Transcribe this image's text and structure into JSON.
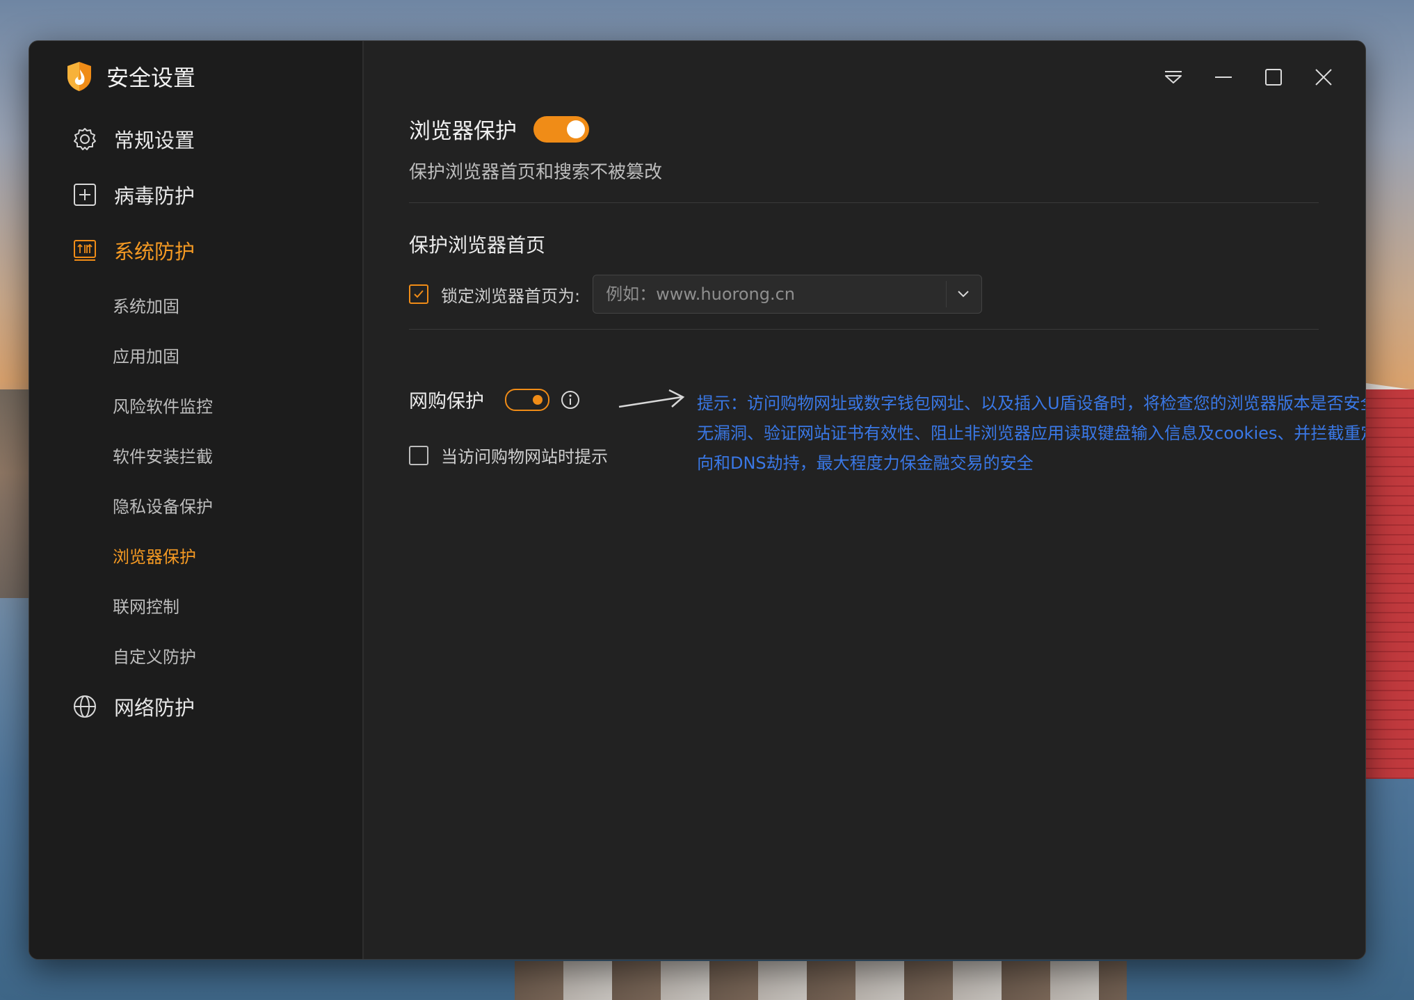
{
  "app": {
    "title": "安全设置"
  },
  "sidebar": {
    "main_items": [
      {
        "label": "常规设置",
        "icon": "gear-icon"
      },
      {
        "label": "病毒防护",
        "icon": "plus-box-icon"
      },
      {
        "label": "系统防护",
        "icon": "system-protect-icon",
        "active": true
      },
      {
        "label": "网络防护",
        "icon": "globe-icon"
      }
    ],
    "sub_items": [
      {
        "label": "系统加固"
      },
      {
        "label": "应用加固"
      },
      {
        "label": "风险软件监控"
      },
      {
        "label": "软件安装拦截"
      },
      {
        "label": "隐私设备保护"
      },
      {
        "label": "浏览器保护",
        "active": true
      },
      {
        "label": "联网控制"
      },
      {
        "label": "自定义防护"
      }
    ]
  },
  "window_controls": [
    "menu-icon",
    "minimize-icon",
    "maximize-icon",
    "close-icon"
  ],
  "content": {
    "title": "浏览器保护",
    "toggle_on": true,
    "description": "保护浏览器首页和搜索不被篡改",
    "homepage_section": {
      "title": "保护浏览器首页",
      "lock_label": "锁定浏览器首页为:",
      "lock_checked": true,
      "url_placeholder": "例如：www.huorong.cn",
      "url_value": ""
    },
    "shopping_section": {
      "title": "网购保护",
      "toggle_on": true,
      "prompt_label": "当访问购物网站时提示",
      "prompt_checked": false,
      "hint_text": "提示：访问购物网址或数字钱包网址、以及插入U盾设备时，将检查您的浏览器版本是否安全无漏洞、验证网站证书有效性、阻止非浏览器应用读取键盘输入信息及cookies、并拦截重定向和DNS劫持，最大程度力保金融交易的安全"
    }
  },
  "colors": {
    "accent": "#f08c17",
    "hint": "#3a78e6",
    "bg": "#222222",
    "sidebar_bg": "#1c1c1c"
  }
}
